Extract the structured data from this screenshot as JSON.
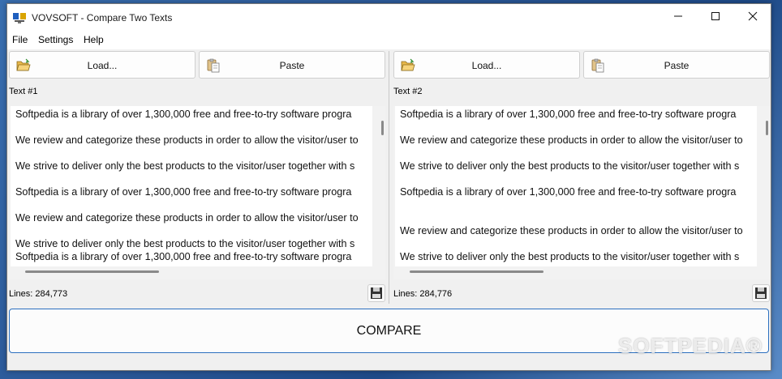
{
  "window": {
    "title": "VOVSOFT - Compare Two Texts",
    "accent": "#2b6fbf"
  },
  "menu": [
    "File",
    "Settings",
    "Help"
  ],
  "left": {
    "load_label": "Load...",
    "paste_label": "Paste",
    "text_label": "Text #1",
    "lines": [
      "Softpedia is a library of over 1,300,000 free and free-to-try software progra",
      "We review and categorize these products in order to allow the visitor/user to",
      "We strive to deliver only the best products to the visitor/user together with s",
      "Softpedia is a library of over 1,300,000 free and free-to-try software progra",
      "We review and categorize these products in order to allow the visitor/user to",
      "We strive to deliver only the best products to the visitor/user together with s",
      "Softpedia is a library of over 1,300,000 free and free-to-try software progra"
    ],
    "status": "Lines: 284,773"
  },
  "right": {
    "load_label": "Load...",
    "paste_label": "Paste",
    "text_label": "Text #2",
    "lines": [
      "Softpedia is a library of over 1,300,000 free and free-to-try software progra",
      "We review and categorize these products in order to allow the visitor/user to",
      "We strive to deliver only the best products to the visitor/user together with s",
      "Softpedia is a library of over 1,300,000 free and free-to-try software progra",
      "",
      "We review and categorize these products in order to allow the visitor/user to",
      "We strive to deliver only the best products to the visitor/user together with s"
    ],
    "status": "Lines: 284,776"
  },
  "compare_label": "COMPARE",
  "watermark": "SOFTPEDIA®",
  "icons": {
    "app": "app-monitor-icon",
    "load": "folder-open-icon",
    "paste": "clipboard-paste-icon",
    "save": "floppy-disk-icon"
  }
}
